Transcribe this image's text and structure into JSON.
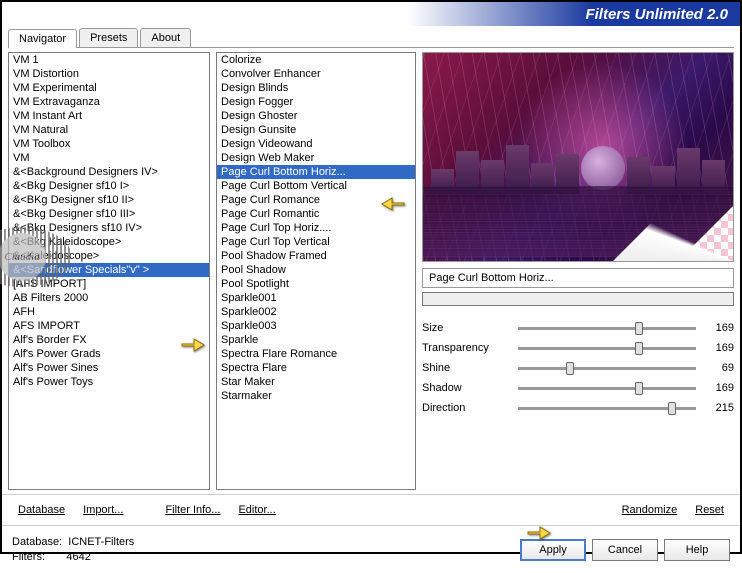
{
  "title": "Filters Unlimited 2.0",
  "tabs": [
    "Navigator",
    "Presets",
    "About"
  ],
  "activeTab": 0,
  "categories": [
    "VM 1",
    "VM Distortion",
    "VM Experimental",
    "VM Extravaganza",
    "VM Instant Art",
    "VM Natural",
    "VM Toolbox",
    "VM",
    "&<Background Designers IV>",
    "&<Bkg Designer sf10 I>",
    "&<BKg Designer sf10 II>",
    "&<Bkg Designer sf10 III>",
    "&<Bkg Designers sf10 IV>",
    "&<Bkg Kaleidoscope>",
    "&<Kaleidoscope>",
    "&<Sandflower Specials\"v\" >",
    "[AFS IMPORT]",
    "AB Filters 2000",
    "AFH",
    "AFS IMPORT",
    "Alf's Border FX",
    "Alf's Power Grads",
    "Alf's Power Sines",
    "Alf's Power Toys"
  ],
  "categorySelectedIndex": 15,
  "filters": [
    "Colorize",
    "Convolver Enhancer",
    "Design Blinds",
    "Design Fogger",
    "Design Ghoster",
    "Design Gunsite",
    "Design Videowand",
    "Design Web Maker",
    "Page Curl Bottom Horiz...",
    "Page Curl Bottom Vertical",
    "Page Curl Romance",
    "Page Curl Romantic",
    "Page Curl Top Horiz....",
    "Page Curl Top Vertical",
    "Pool Shadow Framed",
    "Pool Shadow",
    "Pool Spotlight",
    "Sparkle001",
    "Sparkle002",
    "Sparkle003",
    "Sparkle",
    "Spectra Flare Romance",
    "Spectra Flare",
    "Star Maker",
    "Starmaker"
  ],
  "filterSelectedIndex": 8,
  "currentFilter": "Page Curl Bottom Horiz...",
  "params": [
    {
      "name": "Size",
      "value": 169,
      "pos": 66
    },
    {
      "name": "Transparency",
      "value": 169,
      "pos": 66
    },
    {
      "name": "Shine",
      "value": 69,
      "pos": 27
    },
    {
      "name": "Shadow",
      "value": 169,
      "pos": 66
    },
    {
      "name": "Direction",
      "value": 215,
      "pos": 84
    }
  ],
  "bottomLinks": {
    "database": "Database",
    "import": "Import...",
    "filterinfo": "Filter Info...",
    "editor": "Editor...",
    "randomize": "Randomize",
    "reset": "Reset"
  },
  "status": {
    "dbLabel": "Database:",
    "dbValue": "ICNET-Filters",
    "filtersLabel": "Filters:",
    "filtersValue": "4642"
  },
  "buttons": {
    "apply": "Apply",
    "cancel": "Cancel",
    "help": "Help"
  },
  "watermark": "Claudia"
}
